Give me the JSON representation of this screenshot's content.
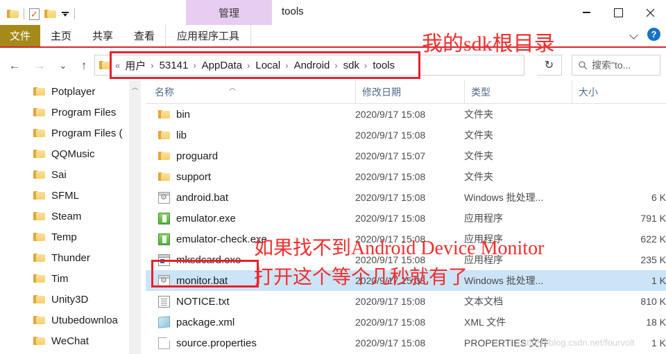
{
  "window": {
    "title": "tools",
    "contextual_tab_header": "管理",
    "minimize_label": "最小化",
    "maximize_label": "最大化",
    "close_label": "关闭"
  },
  "quick_access": {
    "items": [
      {
        "name": "folder-icon",
        "label": ""
      },
      {
        "name": "properties-icon",
        "label": ""
      },
      {
        "name": "new-folder-icon",
        "label": ""
      },
      {
        "name": "customize-dropdown-icon",
        "label": ""
      }
    ]
  },
  "ribbon": {
    "tabs": [
      {
        "label": "文件",
        "active": false,
        "kind": "file"
      },
      {
        "label": "主页",
        "active": false,
        "kind": "normal"
      },
      {
        "label": "共享",
        "active": false,
        "kind": "normal"
      },
      {
        "label": "查看",
        "active": false,
        "kind": "normal"
      },
      {
        "label": "应用程序工具",
        "active": true,
        "kind": "contextual"
      }
    ],
    "expand_icon": "chevron-down-icon",
    "help_label": "?"
  },
  "nav": {
    "back_icon": "←",
    "forward_icon": "→",
    "recent_icon": "⌄",
    "up_icon": "↑",
    "dropdown_icon": "⌄",
    "refresh_icon": "↻"
  },
  "address": {
    "prefix": "«",
    "crumbs": [
      "用户",
      "53141",
      "AppData",
      "Local",
      "Android",
      "sdk",
      "tools"
    ],
    "separator": "›"
  },
  "search": {
    "icon": "search-icon",
    "placeholder": "搜索\"to...",
    "value": ""
  },
  "tree": {
    "items": [
      {
        "label": "Potplayer"
      },
      {
        "label": "Program Files"
      },
      {
        "label": "Program Files ("
      },
      {
        "label": "QQMusic"
      },
      {
        "label": "Sai"
      },
      {
        "label": "SFML"
      },
      {
        "label": "Steam"
      },
      {
        "label": "Temp"
      },
      {
        "label": "Thunder"
      },
      {
        "label": "Tim"
      },
      {
        "label": "Unity3D"
      },
      {
        "label": "Utubedownloa"
      },
      {
        "label": "WeChat"
      }
    ]
  },
  "list": {
    "columns": [
      {
        "label": "名称",
        "sorted": true,
        "sort_dir": "asc"
      },
      {
        "label": "修改日期",
        "sorted": false
      },
      {
        "label": "类型",
        "sorted": false
      },
      {
        "label": "大小",
        "sorted": false
      }
    ],
    "rows": [
      {
        "name": "bin",
        "date": "2020/9/17 15:08",
        "type": "文件夹",
        "size": "",
        "icon": "folder-icon",
        "selected": false
      },
      {
        "name": "lib",
        "date": "2020/9/17 15:08",
        "type": "文件夹",
        "size": "",
        "icon": "folder-icon",
        "selected": false
      },
      {
        "name": "proguard",
        "date": "2020/9/17 15:07",
        "type": "文件夹",
        "size": "",
        "icon": "folder-icon",
        "selected": false
      },
      {
        "name": "support",
        "date": "2020/9/17 15:08",
        "type": "文件夹",
        "size": "",
        "icon": "folder-icon",
        "selected": false
      },
      {
        "name": "android.bat",
        "date": "2020/9/17 15:08",
        "type": "Windows 批处理...",
        "size": "6 K",
        "icon": "bat-file-icon",
        "selected": false
      },
      {
        "name": "emulator.exe",
        "date": "2020/9/17 15:08",
        "type": "应用程序",
        "size": "791 K",
        "icon": "exe-file-icon",
        "selected": false
      },
      {
        "name": "emulator-check.exe",
        "date": "2020/9/17 15:08",
        "type": "应用程序",
        "size": "622 K",
        "icon": "exe-file-icon",
        "selected": false
      },
      {
        "name": "mksdcard.exe",
        "date": "2020/9/17 15:08",
        "type": "应用程序",
        "size": "235 K",
        "icon": "mksdcard-icon",
        "selected": false
      },
      {
        "name": "monitor.bat",
        "date": "2020/9/17 15:08",
        "type": "Windows 批处理...",
        "size": "1 K",
        "icon": "bat-file-icon",
        "selected": true
      },
      {
        "name": "NOTICE.txt",
        "date": "2020/9/17 15:08",
        "type": "文本文档",
        "size": "810 K",
        "icon": "txt-file-icon",
        "selected": false
      },
      {
        "name": "package.xml",
        "date": "2020/9/17 15:08",
        "type": "XML 文件",
        "size": "18 K",
        "icon": "xml-file-icon",
        "selected": false
      },
      {
        "name": "source.properties",
        "date": "2020/9/17 15:08",
        "type": "PROPERTIES 文件",
        "size": "1 K",
        "icon": "plain-file-icon",
        "selected": false
      }
    ]
  },
  "annotations": {
    "color": "#f12d2d",
    "sdk_root_note": "我的sdk根目录",
    "monitor_note_line1": "如果找不到Android Device Monitor",
    "monitor_note_line2": "打开这个等个几秒就有了"
  },
  "watermark": "https://blog.csdn.net/fourvolt"
}
